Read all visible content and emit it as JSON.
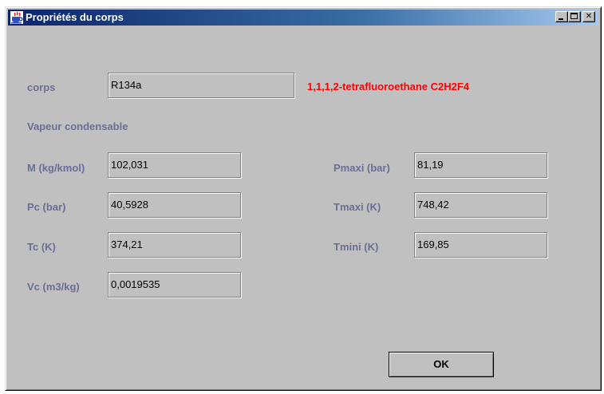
{
  "window": {
    "title": "Propriétés du corps",
    "icon": "coffee-cup-icon"
  },
  "substance": {
    "label": "corps",
    "value": "R134a",
    "full_name": "1,1,1,2-tetrafluoroethane C2H2F4"
  },
  "section_title": "Vapeur condensable",
  "properties_left": [
    {
      "label": "M (kg/kmol)",
      "value": "102,031"
    },
    {
      "label": "Pc (bar)",
      "value": "40,5928"
    },
    {
      "label": "Tc (K)",
      "value": "374,21"
    },
    {
      "label": "Vc (m3/kg)",
      "value": "0,0019535"
    }
  ],
  "properties_right": [
    {
      "label": "Pmaxi (bar)",
      "value": "81,19"
    },
    {
      "label": "Tmaxi (K)",
      "value": "748,42"
    },
    {
      "label": "Tmini (K)",
      "value": "169,85"
    }
  ],
  "ok_button": "OK",
  "colors": {
    "label": "#6a6e96",
    "full_name": "#ff0000",
    "window_bg": "#c0c0c0",
    "titlebar": "#0a246a"
  }
}
